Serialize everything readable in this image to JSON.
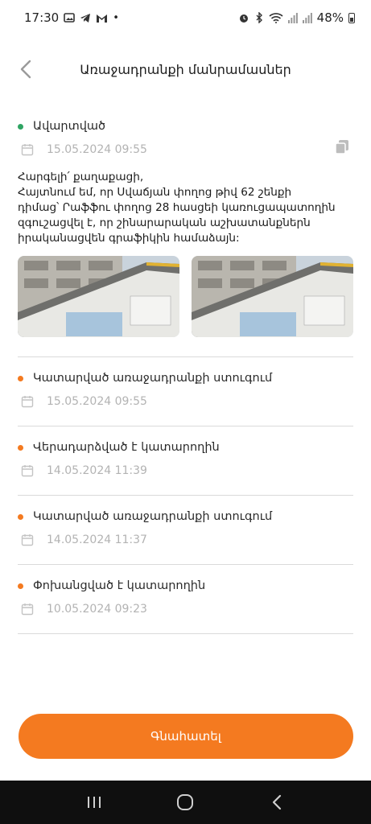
{
  "status_bar": {
    "time": "17:30",
    "notification_dot": "•",
    "battery": "48%"
  },
  "header": {
    "title": "Առաջադրանքի մանրամասներ"
  },
  "colors": {
    "green_dot": "#2fa463",
    "orange_dot": "#f47a20",
    "accent": "#f47a20"
  },
  "current_status": {
    "title": "Ավարտված",
    "date": "15.05.2024 09:55",
    "message_lines": [
      "Հարգելի՛ քաղաքացի,",
      "Հայտնում եմ, որ Սվաճյան փողոց թիվ 62 շենքի",
      "դիմաց՝ Րաֆֆու փողոց 28 հասցեի կառուցապատողին",
      "զգուշացվել է, որ շինարարական աշխատանքներն",
      "իրականացվեն գրաֆիկին համաձայն:"
    ]
  },
  "history": [
    {
      "title": "Կատարված առաջադրանքի ստուգում",
      "date": "15.05.2024 09:55"
    },
    {
      "title": "Վերադարձված է կատարողին",
      "date": "14.05.2024 11:39"
    },
    {
      "title": "Կատարված առաջադրանքի ստուգում",
      "date": "14.05.2024 11:37"
    },
    {
      "title": "Փոխանցված է կատարողին",
      "date": "10.05.2024 09:23"
    }
  ],
  "actions": {
    "continue_label": "Գնահատել"
  },
  "icons": {
    "back": "chevron-left-icon",
    "calendar": "calendar-icon",
    "copy": "copy-icon",
    "nav_recent": "recent-apps-icon",
    "nav_home": "home-icon",
    "nav_back": "back-icon"
  }
}
